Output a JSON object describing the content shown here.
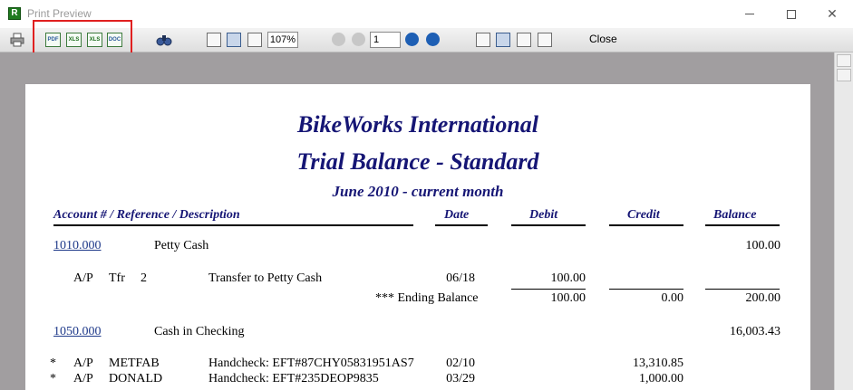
{
  "window": {
    "title": "Print Preview",
    "app_icon_letter": "R"
  },
  "toolbar": {
    "export_formats": [
      "PDF",
      "XLS",
      "XLS",
      "DOC"
    ],
    "zoom": "107%",
    "page": "1",
    "close_label": "Close"
  },
  "report": {
    "company": "BikeWorks International",
    "title": "Trial Balance - Standard",
    "period": "June 2010 - current month",
    "columns": {
      "account": "Account # / Reference / Description",
      "date": "Date",
      "debit": "Debit",
      "credit": "Credit",
      "balance": "Balance"
    },
    "accounts": [
      {
        "number": "1010.000",
        "name": "Petty Cash",
        "balance": "100.00",
        "lines": [
          {
            "flag": "",
            "src": "A/P",
            "ref": "Tfr",
            "num": "2",
            "desc": "Transfer to Petty Cash",
            "date": "06/18",
            "debit": "100.00",
            "credit": ""
          }
        ],
        "ending": {
          "label": "*** Ending Balance",
          "debit": "100.00",
          "credit": "0.00",
          "balance": "200.00"
        }
      },
      {
        "number": "1050.000",
        "name": "Cash in Checking",
        "balance": "16,003.43",
        "lines": [
          {
            "flag": "*",
            "src": "A/P",
            "ref": "METFAB",
            "num": "",
            "desc": "Handcheck: EFT#87CHY05831951AS7",
            "date": "02/10",
            "debit": "",
            "credit": "13,310.85"
          },
          {
            "flag": "*",
            "src": "A/P",
            "ref": "DONALD",
            "num": "",
            "desc": "Handcheck: EFT#235DEOP9835",
            "date": "03/29",
            "debit": "",
            "credit": "1,000.00"
          }
        ]
      }
    ]
  }
}
